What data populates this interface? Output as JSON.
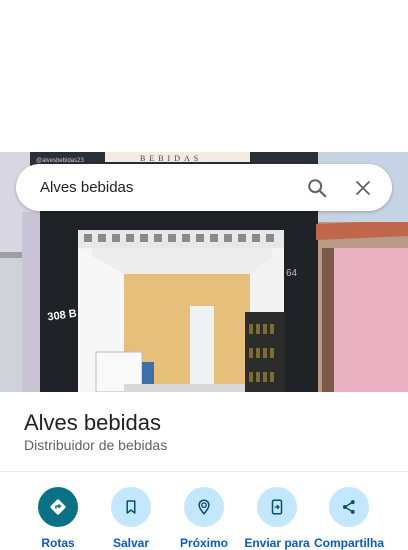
{
  "search": {
    "query": "Alves bebidas"
  },
  "place": {
    "name": "Alves bebidas",
    "category": "Distribuidor de bebidas"
  },
  "photo": {
    "sign_handle": "@alvesbebidas23",
    "sign_text": "BEBIDAS",
    "wall_number": "308 B",
    "side_number": "64"
  },
  "actions": [
    {
      "label": "Rotas",
      "icon": "directions-icon"
    },
    {
      "label": "Salvar",
      "icon": "bookmark-icon"
    },
    {
      "label": "Próximo",
      "icon": "nearby-icon"
    },
    {
      "label": "Enviar para",
      "icon": "send-to-phone-icon"
    },
    {
      "label": "Compartilha",
      "icon": "share-icon"
    }
  ],
  "colors": {
    "primary_action": "#0b7285",
    "action_bg": "#c2e7ff",
    "action_label": "#0b57d0"
  }
}
